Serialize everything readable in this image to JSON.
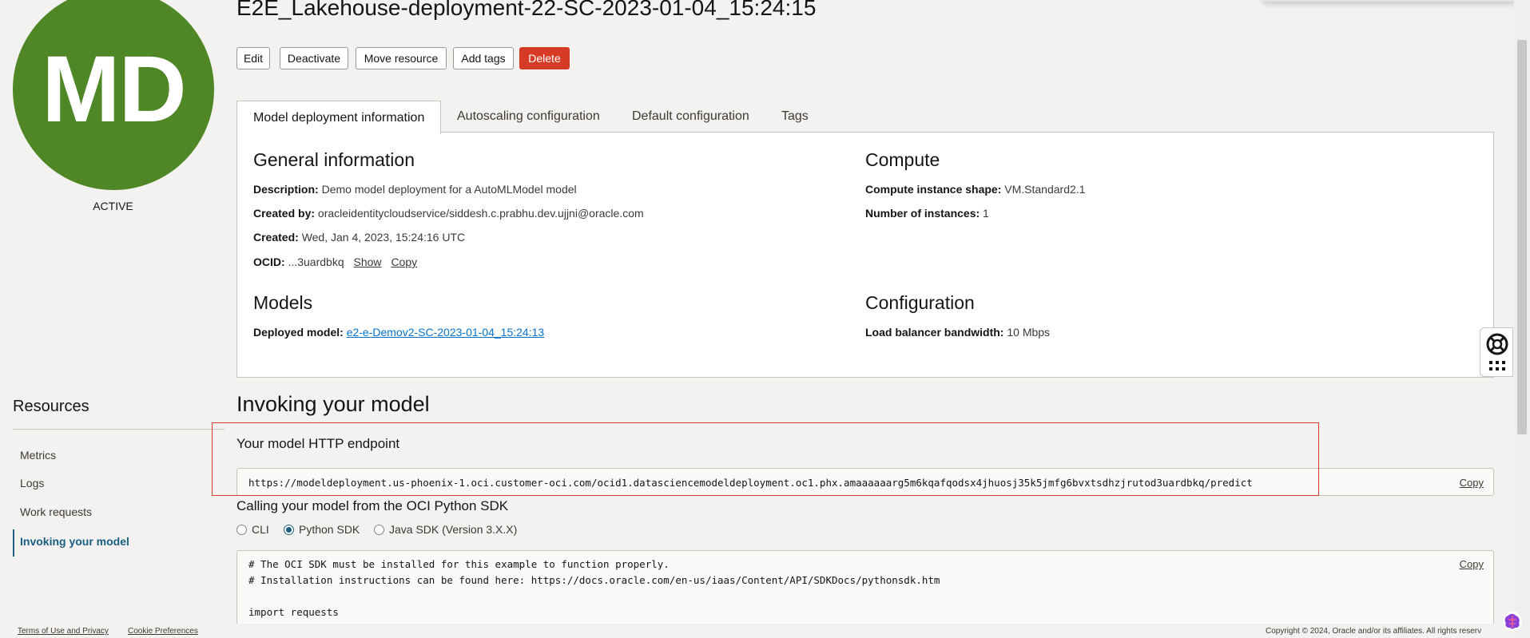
{
  "avatar": {
    "initials": "MD",
    "status": "ACTIVE",
    "color": "#4f8726"
  },
  "title": "E2E_Lakehouse-deployment-22-SC-2023-01-04_15:24:15",
  "actions": [
    "Edit",
    "Deactivate",
    "Move resource",
    "Add tags",
    "Delete"
  ],
  "tabs": [
    "Model deployment information",
    "Autoscaling configuration",
    "Default configuration",
    "Tags"
  ],
  "general": {
    "heading": "General information",
    "description_label": "Description:",
    "description": "Demo model deployment for a AutoMLModel model",
    "created_by_label": "Created by:",
    "created_by": "oracleidentitycloudservice/siddesh.c.prabhu.dev.ujjni@oracle.com",
    "created_label": "Created:",
    "created": "Wed, Jan 4, 2023, 15:24:16 UTC",
    "ocid_label": "OCID:",
    "ocid": "...3uardbkq",
    "show": "Show",
    "copy": "Copy"
  },
  "compute": {
    "heading": "Compute",
    "shape_label": "Compute instance shape:",
    "shape": "VM.Standard2.1",
    "instances_label": "Number of instances:",
    "instances": "1"
  },
  "models": {
    "heading": "Models",
    "deployed_label": "Deployed model:",
    "deployed": "e2-e-Demov2-SC-2023-01-04_15:24:13"
  },
  "configuration": {
    "heading": "Configuration",
    "bandwidth_label": "Load balancer bandwidth:",
    "bandwidth": "10 Mbps"
  },
  "resources": {
    "heading": "Resources",
    "items": [
      "Metrics",
      "Logs",
      "Work requests",
      "Invoking your model"
    ]
  },
  "invoking": {
    "heading": "Invoking your model",
    "endpoint_label": "Your model HTTP endpoint",
    "endpoint": "https://modeldeployment.us-phoenix-1.oci.customer-oci.com/ocid1.datasciencemodeldeployment.oc1.phx.amaaaaaarg5m6kqafqodsx4jhuosj35k5jmfg6bvxtsdhzjrutod3uardbkq/predict",
    "copy": "Copy",
    "sdk_label": "Calling your model from the OCI Python SDK",
    "options": [
      "CLI",
      "Python SDK",
      "Java SDK (Version 3.X.X)"
    ],
    "code_lines": [
      "# The OCI SDK must be installed for this example to function properly.",
      "# Installation instructions can be found here: https://docs.oracle.com/en-us/iaas/Content/API/SDKDocs/pythonsdk.htm",
      "",
      "import requests"
    ]
  },
  "footer": {
    "terms": "Terms of Use and Privacy",
    "cookies": "Cookie Preferences",
    "copyright": "Copyright © 2024, Oracle and/or its affiliates. All rights reserv"
  }
}
